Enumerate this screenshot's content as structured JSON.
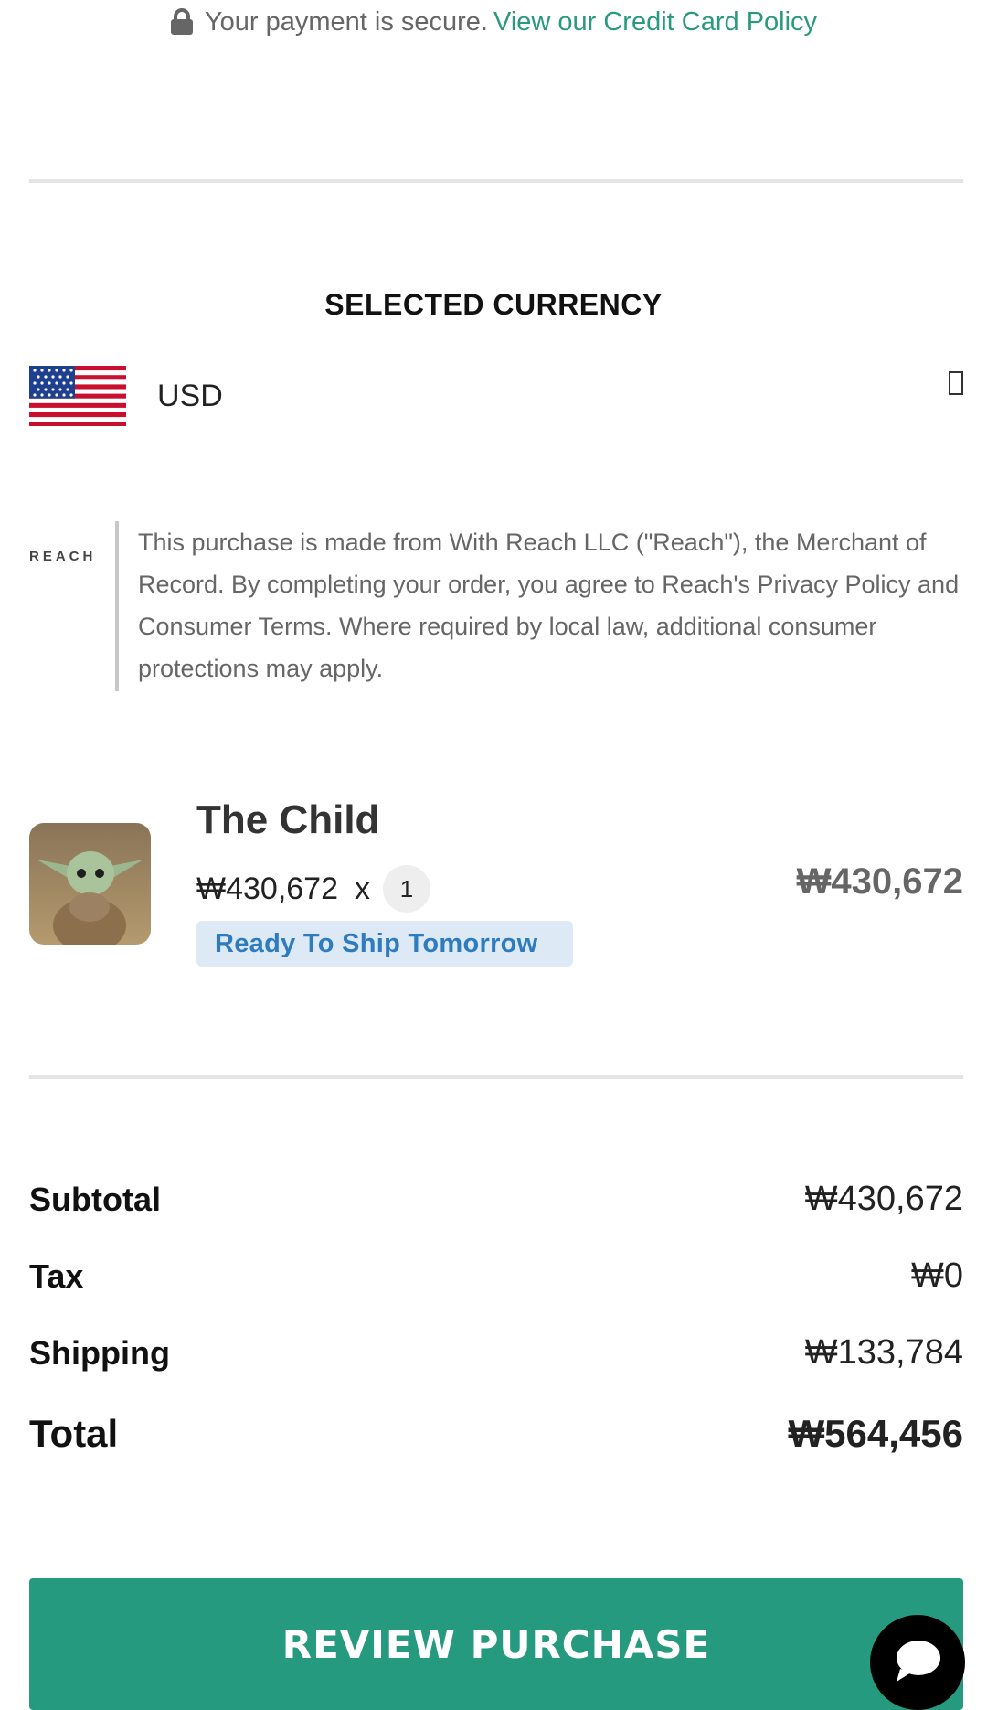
{
  "secure": {
    "text": "Your payment is secure.",
    "link": "View our Credit Card Policy",
    "icon": "lock-icon"
  },
  "currency": {
    "title": "SELECTED CURRENCY",
    "code": "USD",
    "flag": "us-flag-icon",
    "dropdown_icon": "dropdown-icon"
  },
  "merchant": {
    "logo": "REACH",
    "notice": "This purchase is made from With Reach LLC (\"Reach\"), the Merchant of Record. By completing your order, you agree to Reach's Privacy Policy and Consumer Terms. Where required by local law, additional consumer protections may apply."
  },
  "product": {
    "name": "The Child",
    "unit_price": "₩430,672",
    "times": "x",
    "quantity": "1",
    "shipping_badge": "Ready To Ship Tomorrow",
    "line_total": "₩430,672"
  },
  "summary": {
    "subtotal_label": "Subtotal",
    "subtotal_value": "₩430,672",
    "tax_label": "Tax",
    "tax_value": "₩0",
    "shipping_label": "Shipping",
    "shipping_value": "₩133,784",
    "total_label": "Total",
    "total_value": "₩564,456"
  },
  "actions": {
    "review_label": "REVIEW PURCHASE",
    "chat_icon": "chat-bubble-icon"
  },
  "colors": {
    "accent_green": "#259a7f",
    "link_green": "#2a9a7e",
    "badge_bg": "#ddeaf6",
    "badge_text": "#2f7bbf"
  }
}
